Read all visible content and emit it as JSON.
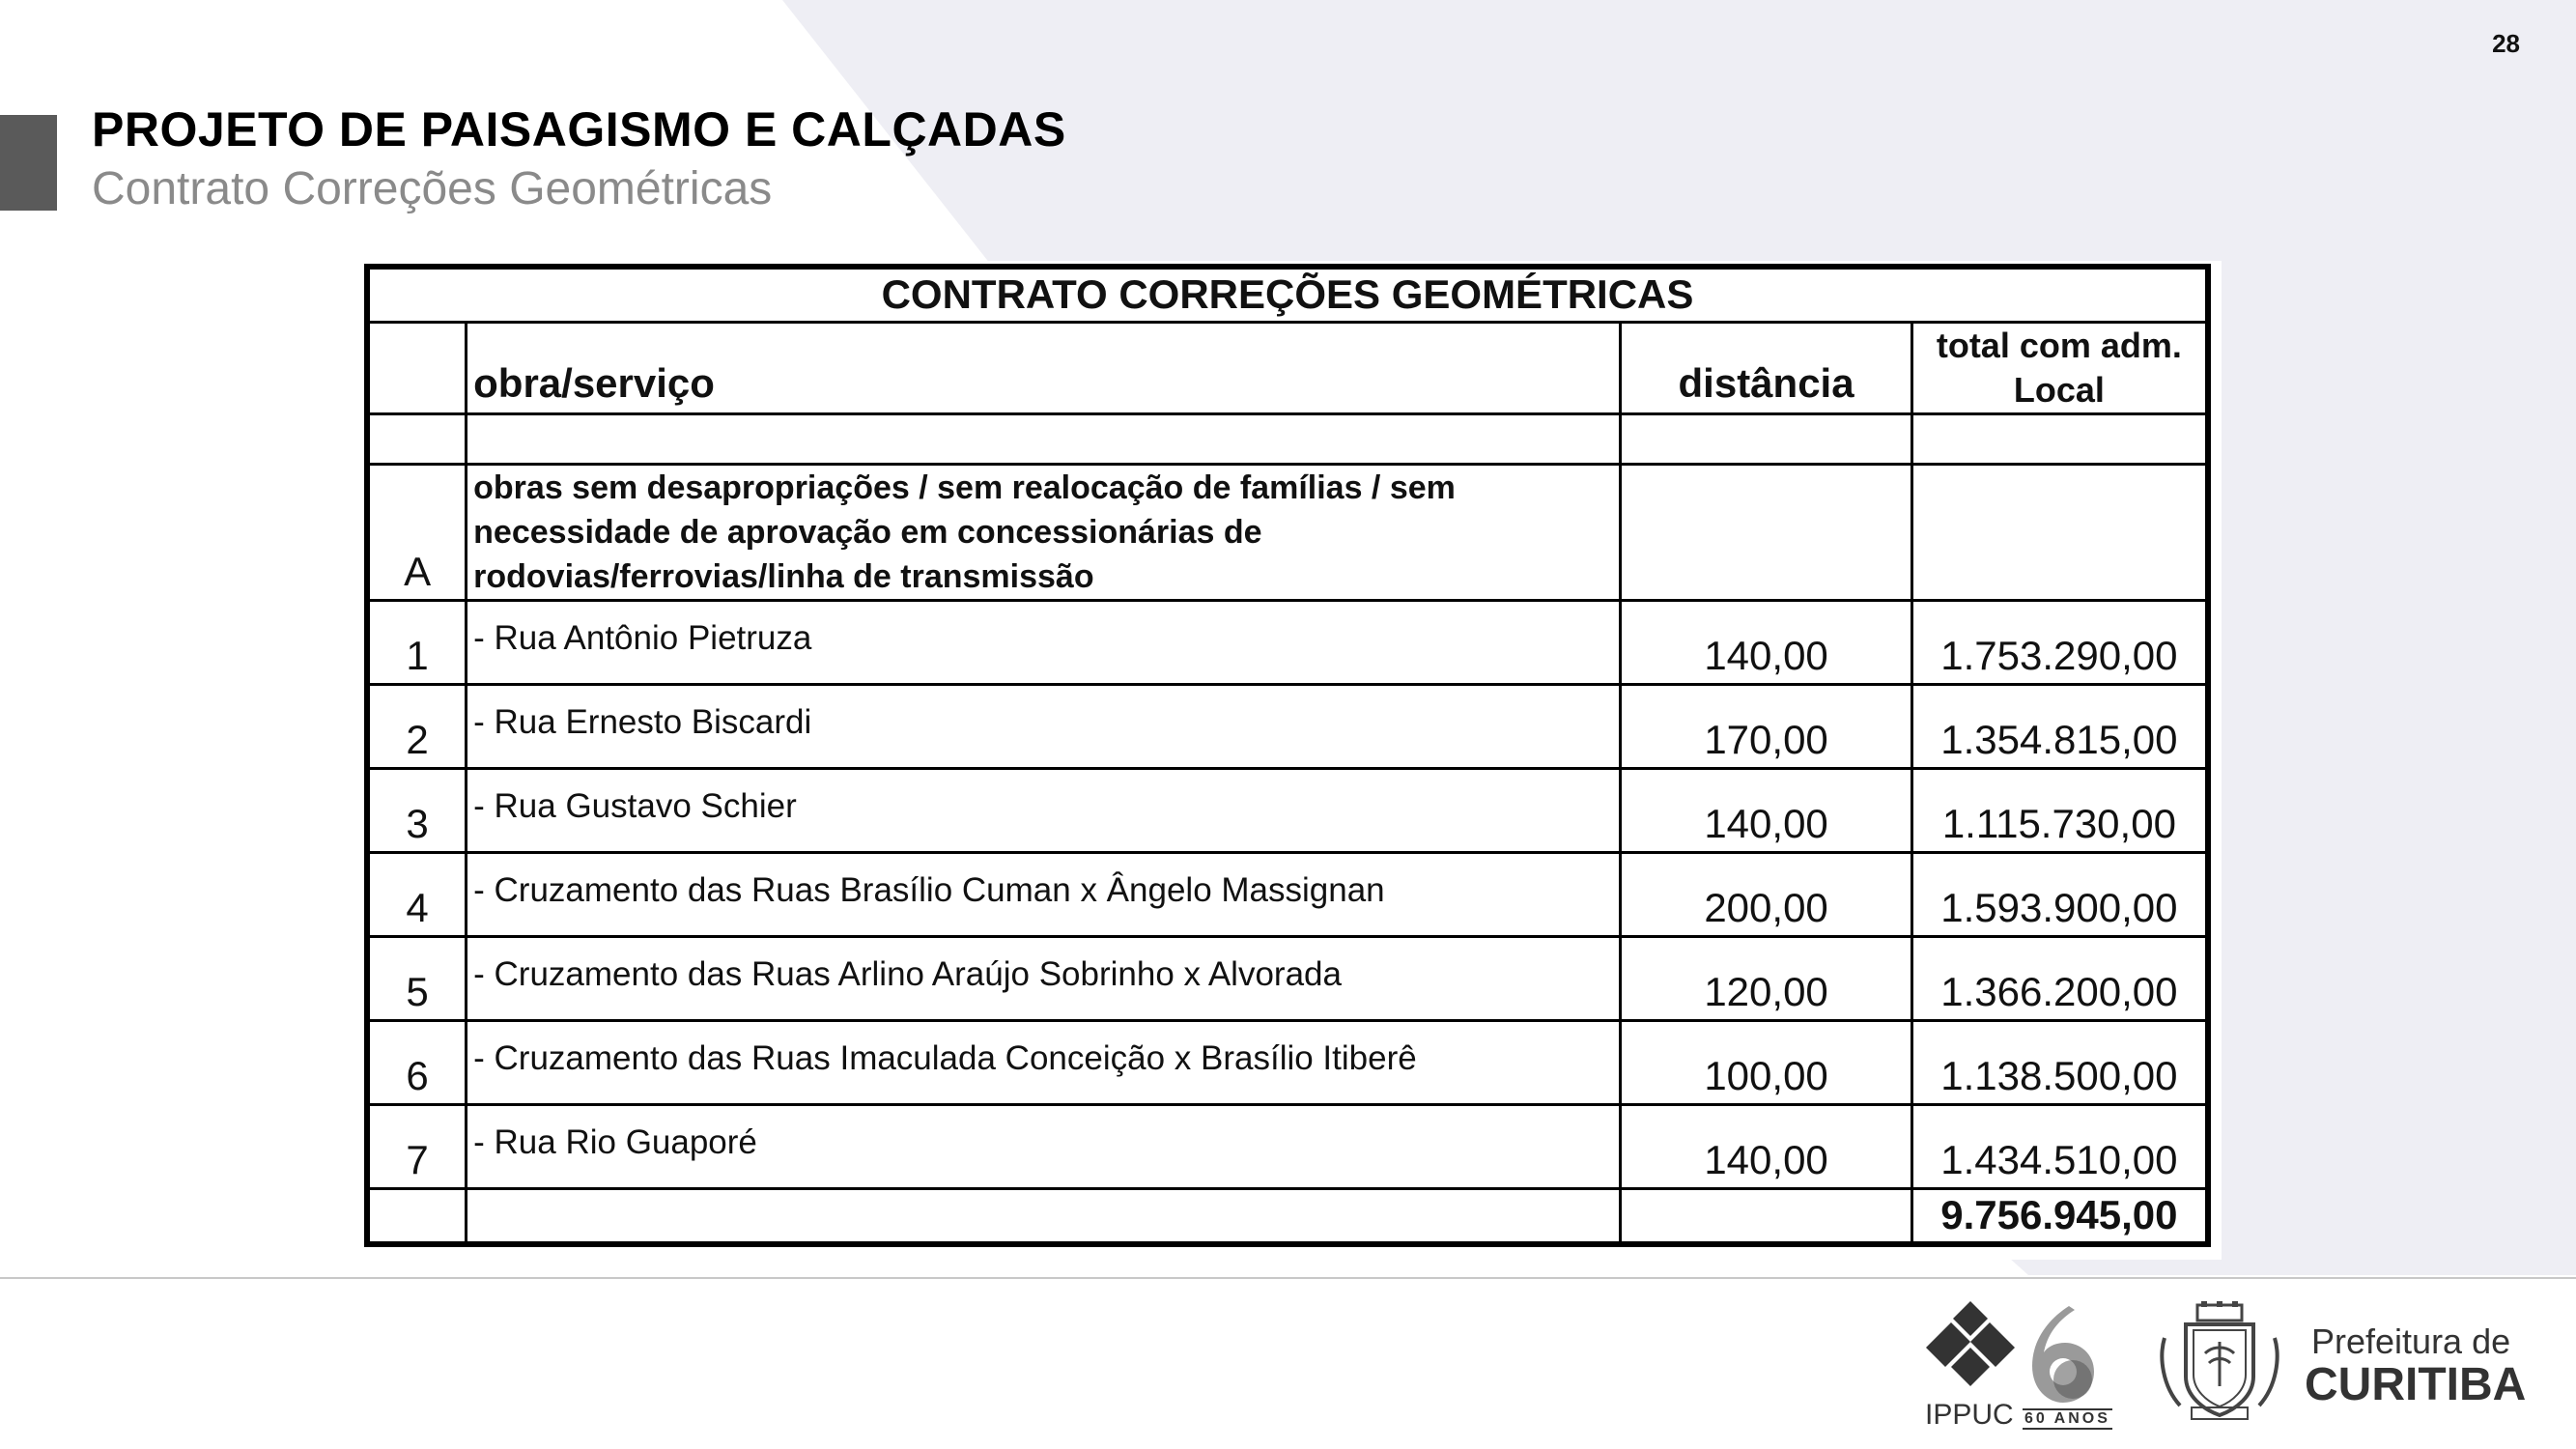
{
  "page": {
    "number": "28",
    "title": "PROJETO DE PAISAGISMO E CALÇADAS",
    "subtitle": "Contrato Correções Geométricas"
  },
  "table": {
    "title": "CONTRATO CORREÇÕES GEOMÉTRICAS",
    "headers": {
      "obra": "obra/serviço",
      "distancia": "distância",
      "total_line1": "total com adm.",
      "total_line2": "Local"
    },
    "group": {
      "letter": "A",
      "line1": "obras sem desapropriações / sem realocação de famílias / sem",
      "line2": "necessidade de aprovação em concessionárias de",
      "line3": "rodovias/ferrovias/linha de transmissão"
    },
    "rows": [
      {
        "num": "1",
        "desc": "- Rua Antônio Pietruza",
        "dist": "140,00",
        "total": "1.753.290,00"
      },
      {
        "num": "2",
        "desc": "- Rua Ernesto Biscardi",
        "dist": "170,00",
        "total": "1.354.815,00"
      },
      {
        "num": "3",
        "desc": "- Rua Gustavo Schier",
        "dist": "140,00",
        "total": "1.115.730,00"
      },
      {
        "num": "4",
        "desc": "- Cruzamento das Ruas Brasílio Cuman x Ângelo Massignan",
        "dist": "200,00",
        "total": "1.593.900,00"
      },
      {
        "num": "5",
        "desc": "- Cruzamento das Ruas Arlino Araújo Sobrinho x Alvorada",
        "dist": "120,00",
        "total": "1.366.200,00"
      },
      {
        "num": "6",
        "desc": "- Cruzamento das Ruas Imaculada Conceição x Brasílio Itiberê",
        "dist": "100,00",
        "total": "1.138.500,00"
      },
      {
        "num": "7",
        "desc": "- Rua Rio Guaporé",
        "dist": "140,00",
        "total": "1.434.510,00"
      }
    ],
    "grand_total": "9.756.945,00"
  },
  "footer": {
    "ippuc_label": "IPPUC",
    "sixty_label": "60 ANOS",
    "prefeitura_line1": "Prefeitura de",
    "prefeitura_line2": "CURITIBA"
  },
  "icons": {
    "ippuc_logo": "ippuc-logo-icon",
    "sixty_logo": "sixty-years-logo-icon",
    "coat_of_arms": "curitiba-coat-of-arms-icon"
  },
  "colors": {
    "accent_bar": "#5a5a5a",
    "subtitle": "#8a8a8a",
    "background_shape": "#eeeef4"
  }
}
